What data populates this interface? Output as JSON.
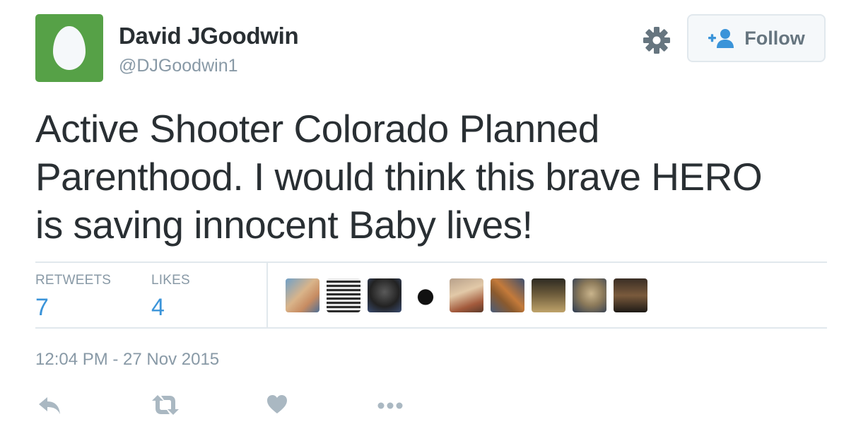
{
  "user": {
    "display_name": "David JGoodwin",
    "handle": "@DJGoodwin1"
  },
  "header": {
    "follow_label": "Follow",
    "settings_icon": "gear-icon",
    "follow_icon": "add-user-icon"
  },
  "tweet": {
    "lines": [
      "Active Shooter Colorado Planned",
      "Parenthood.  I would think this brave HERO",
      "is saving innocent Baby lives!"
    ],
    "timestamp": "12:04 PM - 27 Nov 2015"
  },
  "stats": {
    "retweets_label": "RETWEETS",
    "retweets_value": "7",
    "likes_label": "LIKES",
    "likes_value": "4"
  },
  "actions": {
    "reply_icon": "reply-icon",
    "retweet_icon": "retweet-icon",
    "like_icon": "heart-icon",
    "more_icon": "more-icon"
  },
  "colors": {
    "avatar_bg": "#56a147",
    "link_blue": "#3b94d9",
    "muted": "#8899a6",
    "text": "#292f33",
    "icon": "#aab8c2"
  }
}
